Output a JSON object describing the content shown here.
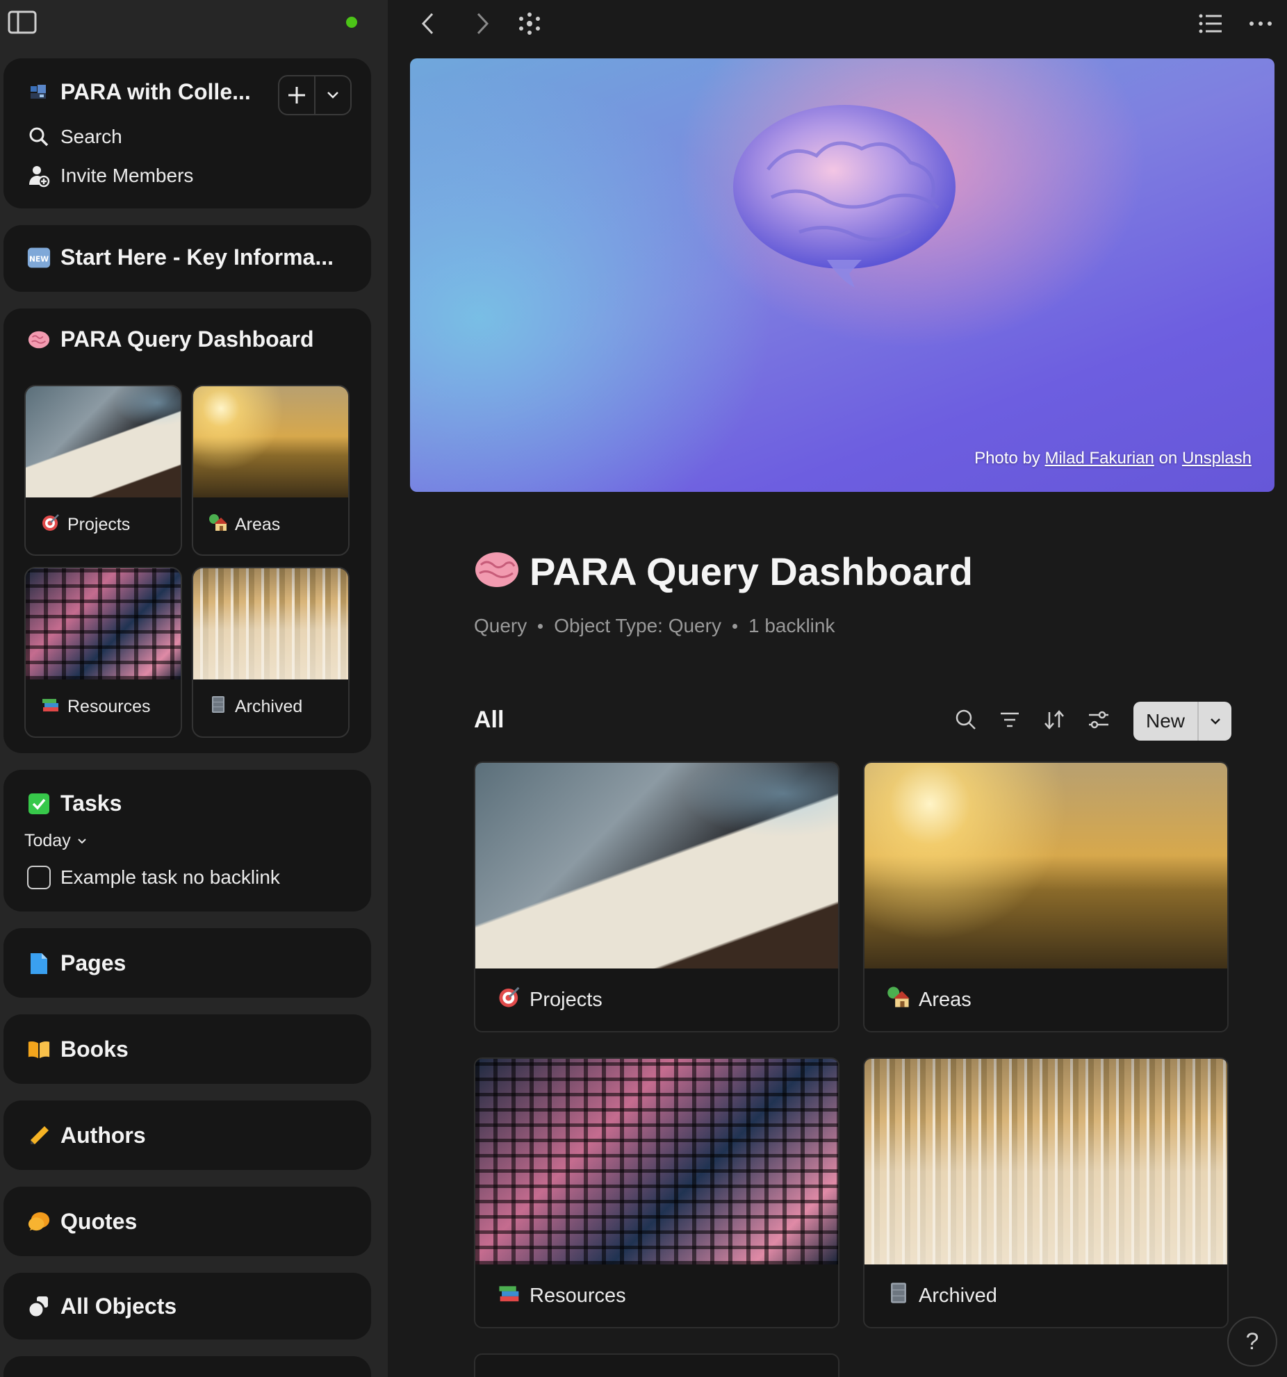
{
  "sidebar": {
    "workspace": {
      "name": "PARA with Colle...",
      "search": "Search",
      "invite": "Invite Members"
    },
    "start_here": "Start Here - Key Informa...",
    "dashboard": {
      "title": "PARA Query Dashboard",
      "items": [
        {
          "label": "Projects",
          "icon": "direct-hit-icon"
        },
        {
          "label": "Areas",
          "icon": "house-with-garden-icon"
        },
        {
          "label": "Resources",
          "icon": "books-icon"
        },
        {
          "label": "Archived",
          "icon": "file-cabinet-icon"
        }
      ]
    },
    "tasks": {
      "title": "Tasks",
      "filter": "Today",
      "items": [
        {
          "label": "Example task no backlink"
        }
      ]
    },
    "sections": [
      "Pages",
      "Books",
      "Authors",
      "Quotes",
      "All Objects"
    ],
    "status_color": "#4cc417"
  },
  "cover": {
    "credit_prefix": "Photo by",
    "credit_author": "Milad Fakurian",
    "credit_mid": "on",
    "credit_site": "Unsplash"
  },
  "page": {
    "title": "PARA Query Dashboard",
    "meta": [
      "Query",
      "Object Type: Query",
      "1 backlink"
    ]
  },
  "view": {
    "label": "All",
    "new_label": "New",
    "cards": [
      {
        "label": "Projects"
      },
      {
        "label": "Areas"
      },
      {
        "label": "Resources"
      },
      {
        "label": "Archived"
      }
    ]
  },
  "help_label": "?"
}
